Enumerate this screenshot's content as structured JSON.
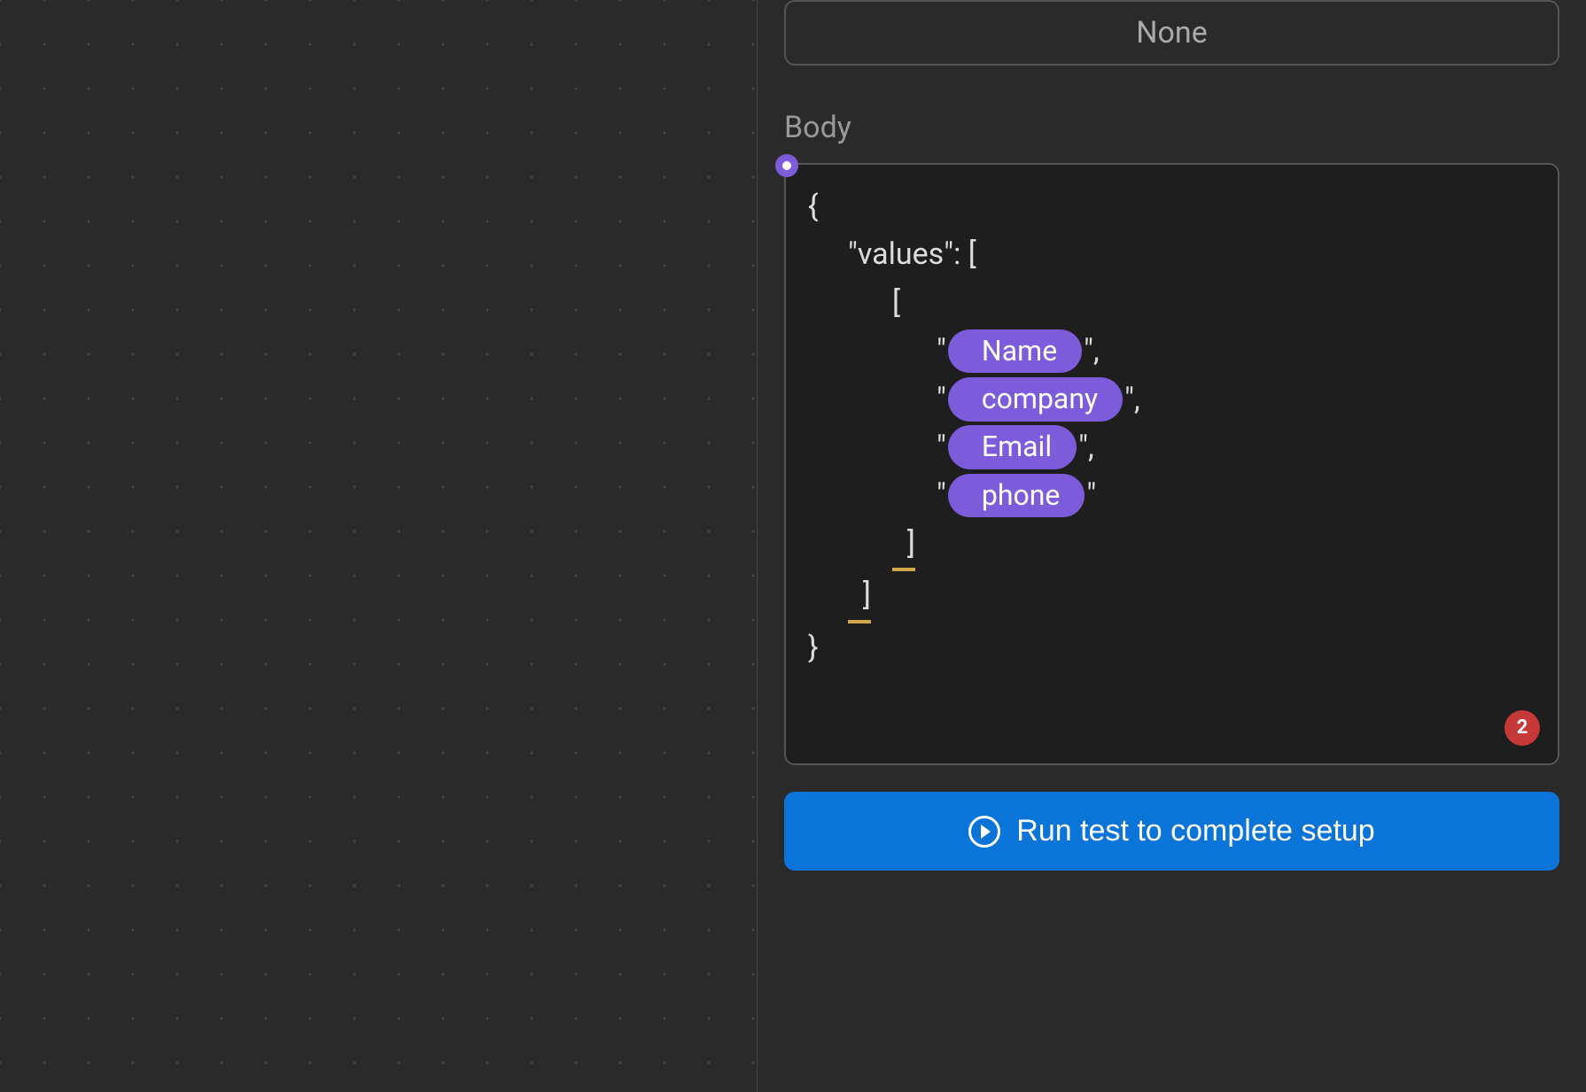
{
  "panel": {
    "none_label": "None",
    "body_label": "Body",
    "code": {
      "key": "\"values\"",
      "pills": [
        "Name",
        "company",
        "Email",
        "phone"
      ]
    },
    "error_count": "2",
    "run_button_label": "Run test to complete setup"
  }
}
